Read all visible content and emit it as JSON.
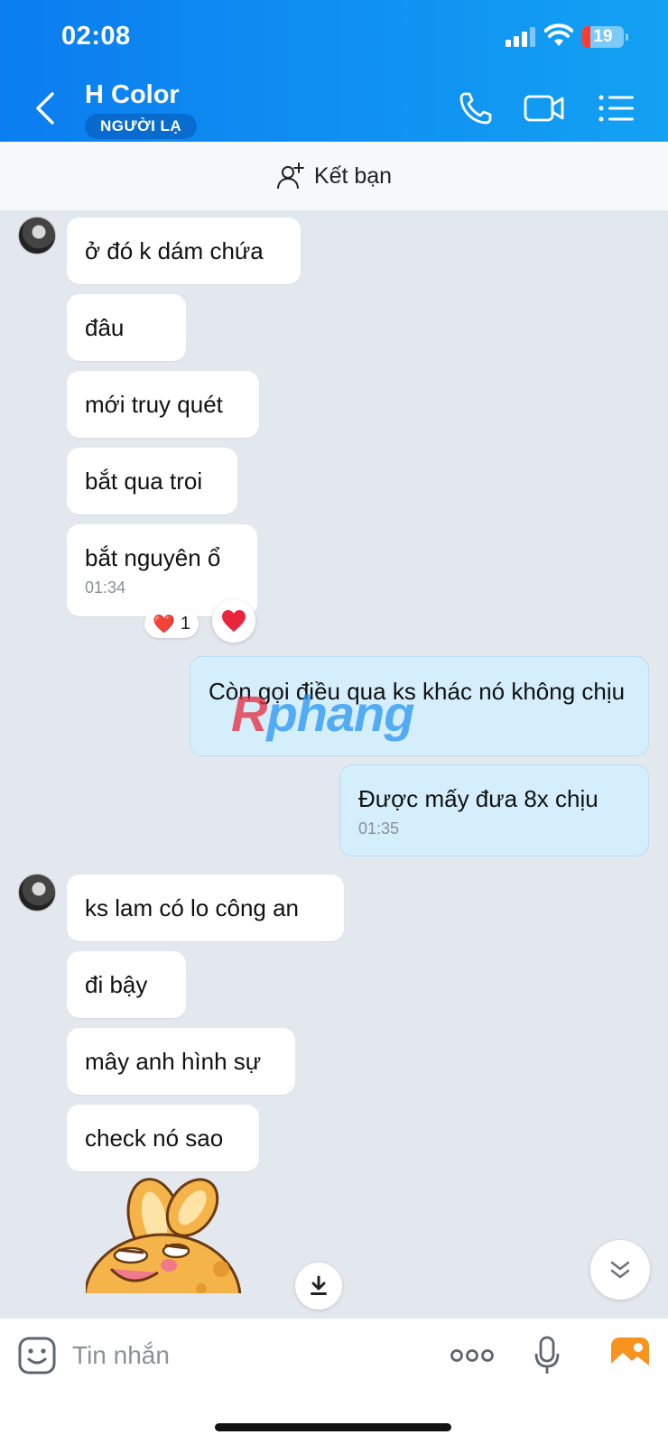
{
  "status_bar": {
    "time": "02:08",
    "battery": "19"
  },
  "header": {
    "contact_name": "H Color",
    "badge": "NGƯỜI LẠ",
    "icons": [
      "back-icon",
      "phone-icon",
      "video-icon",
      "menu-list-icon"
    ],
    "gradient": [
      "#0b7df0",
      "#13a1f3"
    ]
  },
  "friend_bar": {
    "label": "Kết bạn",
    "icon": "add-friend-icon"
  },
  "messages": [
    {
      "side": "in",
      "text": "ở đó k dám chứa"
    },
    {
      "side": "in",
      "text": "đâu"
    },
    {
      "side": "in",
      "text": "mới truy quét"
    },
    {
      "side": "in",
      "text": "bắt qua troi"
    },
    {
      "side": "in",
      "text": "bắt nguyên ổ",
      "time": "01:34"
    },
    {
      "side": "out",
      "text": "Còn gọi điều qua ks khác nó không chịu"
    },
    {
      "side": "out",
      "text": "Được mấy đưa 8x chịu",
      "time": "01:35"
    },
    {
      "side": "in",
      "text": "ks lam có lo công an"
    },
    {
      "side": "in",
      "text": "đi bậy"
    },
    {
      "side": "in",
      "text": "mây anh hình sự"
    },
    {
      "side": "in",
      "text": "check nó sao"
    }
  ],
  "reaction": {
    "emoji": "❤️",
    "count": "1"
  },
  "watermark": {
    "part1": "R",
    "part2": "phang"
  },
  "input": {
    "placeholder": "Tin nhắn"
  },
  "colors": {
    "in_bubble": "#ffffff",
    "out_bubble": "#d4eefc",
    "background": "#e3e8ee"
  }
}
